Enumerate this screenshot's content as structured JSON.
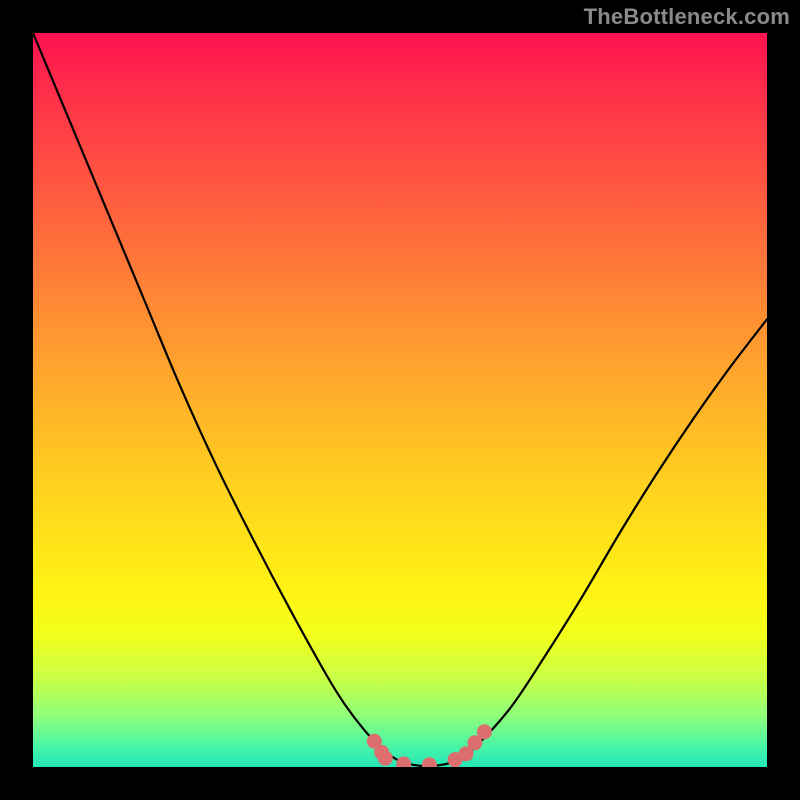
{
  "watermark": {
    "text": "TheBottleneck.com"
  },
  "chart_data": {
    "type": "line",
    "title": "",
    "xlabel": "",
    "ylabel": "",
    "xlim": [
      0,
      1
    ],
    "ylim": [
      0,
      1
    ],
    "series": [
      {
        "name": "bottleneck-curve",
        "x": [
          0.0,
          0.05,
          0.1,
          0.15,
          0.2,
          0.25,
          0.3,
          0.35,
          0.4,
          0.425,
          0.45,
          0.475,
          0.5,
          0.525,
          0.55,
          0.575,
          0.6,
          0.65,
          0.7,
          0.75,
          0.8,
          0.85,
          0.9,
          0.95,
          1.0
        ],
        "y": [
          1.0,
          0.88,
          0.76,
          0.64,
          0.52,
          0.41,
          0.31,
          0.215,
          0.125,
          0.085,
          0.052,
          0.025,
          0.008,
          0.002,
          0.002,
          0.008,
          0.025,
          0.08,
          0.155,
          0.235,
          0.32,
          0.4,
          0.475,
          0.545,
          0.61
        ]
      }
    ],
    "markers": {
      "name": "highlight-dots",
      "color": "#dd6e6e",
      "points": [
        {
          "x": 0.465,
          "y": 0.035
        },
        {
          "x": 0.475,
          "y": 0.02
        },
        {
          "x": 0.48,
          "y": 0.012
        },
        {
          "x": 0.505,
          "y": 0.004
        },
        {
          "x": 0.54,
          "y": 0.003
        },
        {
          "x": 0.575,
          "y": 0.01
        },
        {
          "x": 0.59,
          "y": 0.018
        },
        {
          "x": 0.602,
          "y": 0.033
        },
        {
          "x": 0.615,
          "y": 0.048
        }
      ]
    }
  }
}
